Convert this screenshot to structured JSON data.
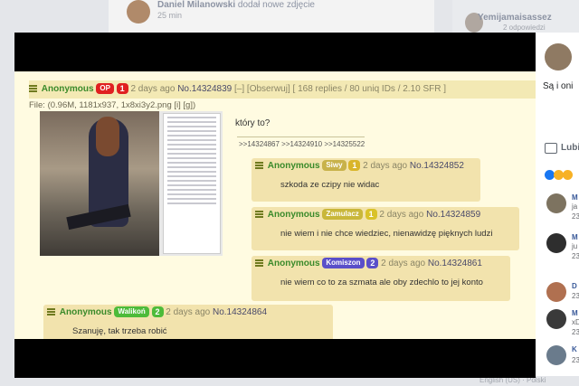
{
  "background": {
    "top_post_name": "Daniel Milanowski",
    "top_post_action": "dodał nowe zdjęcie",
    "top_post_time": "25 min",
    "right_top_name": "Yemijamaisassez",
    "right_top_sub": "2 odpowiedzi",
    "bottom_text": "English (US) · Polski"
  },
  "thread": {
    "op": {
      "name": "Anonymous",
      "badge": "OP",
      "badge_num": "1",
      "time": "2 days ago",
      "no": "No.14324839",
      "controls": "[–] [Obserwuj]",
      "stats": "[ 168 replies / 80 uniq IDs / 2.10 SFR ]",
      "file": "File: (0.96M, 1181x937, 1x8xi3y2.png [i] [g])",
      "text": "który to?",
      "refs": ">>14324867 >>14324910 >>14325522"
    },
    "replies": [
      {
        "name": "Anonymous",
        "id": "Siwy",
        "id_color": "#c8b24a",
        "num": "1",
        "num_color": "#d9b52a",
        "time": "2 days ago",
        "no": "No.14324852",
        "text": "szkoda ze czipy nie widac"
      },
      {
        "name": "Anonymous",
        "id": "Zamulacz",
        "id_color": "#c9b73a",
        "num": "1",
        "num_color": "#d9c22a",
        "time": "2 days ago",
        "no": "No.14324859",
        "text": "nie wiem i nie chce wiedziec, nienawidzę pięknych ludzi"
      },
      {
        "name": "Anonymous",
        "id": "Komiszon",
        "id_color": "#5a4fc9",
        "num": "2",
        "num_color": "#5a4fc9",
        "time": "2 days ago",
        "no": "No.14324861",
        "text": "nie wiem co to za szmata ale oby zdechlo to jej konto"
      },
      {
        "name": "Anonymous",
        "id": "Walikoń",
        "id_color": "#4dbb3a",
        "num": "2",
        "num_color": "#4dbb3a",
        "time": "2 days ago",
        "no": "No.14324864",
        "text": "Szanuję, tak trzeba robić"
      }
    ]
  },
  "fb_panel": {
    "comment_text": "Są i oni",
    "like_label": "Lubi",
    "comments": [
      {
        "initial": "M",
        "snippet": "ja",
        "time": "23"
      },
      {
        "initial": "M",
        "snippet": "ju",
        "time": "23"
      },
      {
        "initial": "D",
        "snippet": "",
        "time": "23"
      },
      {
        "initial": "M",
        "snippet": "xD",
        "time": "23"
      },
      {
        "initial": "K",
        "snippet": "",
        "time": "23"
      }
    ]
  },
  "colors": {
    "board_bg": "#fffbe1",
    "op_bar": "#f3e9b4",
    "reply_bg": "#f2e3ad",
    "name_green": "#3a8a2a",
    "op_badge": "#e02020"
  }
}
